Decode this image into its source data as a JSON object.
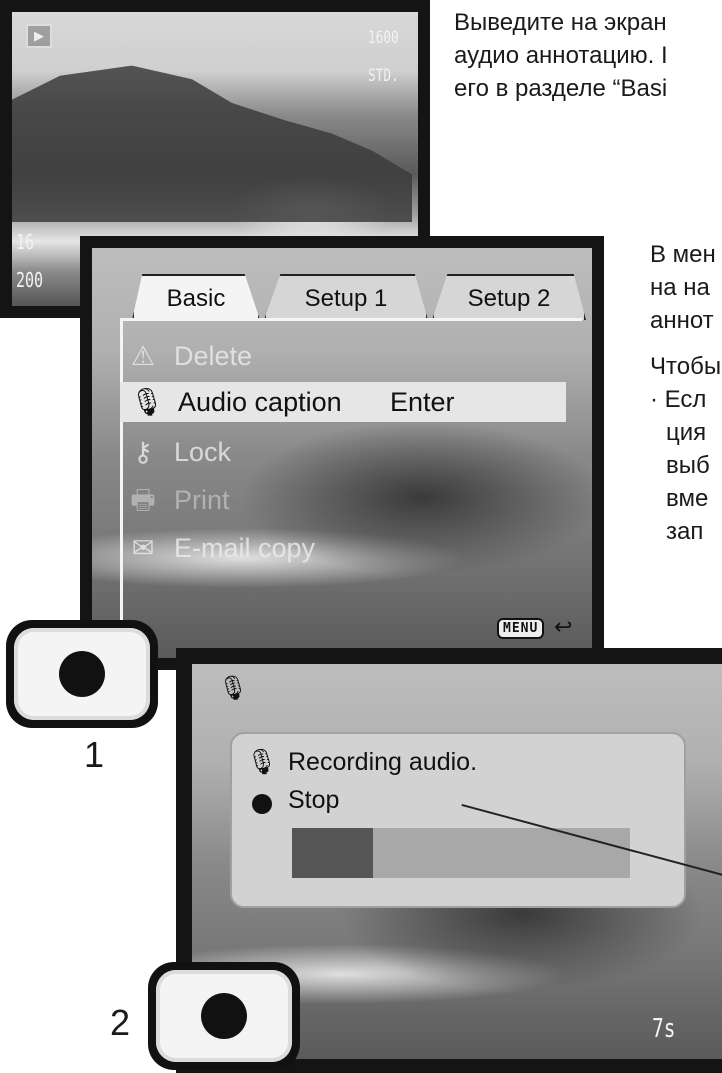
{
  "text": {
    "top": [
      "Выведите на экран",
      "аудио аннотацию. I",
      "его в разделе “Basi"
    ],
    "mid": [
      "В мен",
      "на  на",
      "аннот",
      "Чтобы",
      "· Есл",
      "ция",
      "выб",
      "вме",
      "зап"
    ]
  },
  "screen1": {
    "play_icon": "▶",
    "iso": "1600",
    "quality": "STD.",
    "frame_no": "16",
    "date": "200"
  },
  "menu": {
    "tabs": [
      "Basic",
      "Setup 1",
      "Setup 2"
    ],
    "items": [
      {
        "icon": "warning-icon",
        "glyph": "⚠",
        "label": "Delete"
      },
      {
        "icon": "microphone-icon",
        "glyph": "🎙",
        "label": "Audio caption",
        "value": "Enter"
      },
      {
        "icon": "key-icon",
        "glyph": "⚷",
        "label": "Lock"
      },
      {
        "icon": "print-icon",
        "glyph": "🖶",
        "label": "Print"
      },
      {
        "icon": "envelope-icon",
        "glyph": "✉",
        "label": "E-mail copy"
      }
    ],
    "menu_badge": "MENU",
    "back_glyph": "↩"
  },
  "recording": {
    "mic_glyph": "🎙",
    "title": "Recording audio.",
    "stop_label": "Stop",
    "progress": 0.24,
    "time_left": "7s"
  },
  "steps": [
    "1",
    "2"
  ]
}
